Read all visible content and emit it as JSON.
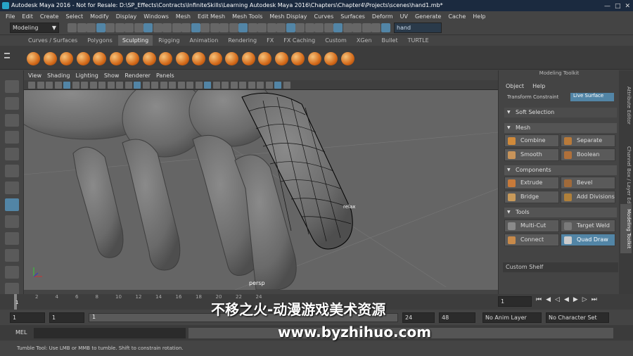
{
  "title": "Autodesk Maya 2016 - Not for Resale: D:\\SP_Effects\\Contracts\\InfiniteSkills\\Learning Autodesk Maya 2016\\Chapters\\Chapter4\\Projects\\scenes\\hand1.mb*",
  "menu": [
    "File",
    "Edit",
    "Create",
    "Select",
    "Modify",
    "Display",
    "Windows",
    "Mesh",
    "Edit Mesh",
    "Mesh Tools",
    "Mesh Display",
    "Curves",
    "Surfaces",
    "Deform",
    "UV",
    "Generate",
    "Cache",
    "Help"
  ],
  "mode_menu": "Modeling",
  "search_value": "hand",
  "shelf_tabs": [
    "Curves / Surfaces",
    "Polygons",
    "Sculpting",
    "Rigging",
    "Animation",
    "Rendering",
    "FX",
    "FX Caching",
    "Custom",
    "XGen",
    "Bullet",
    "TURTLE"
  ],
  "active_shelf_tab": "Sculpting",
  "viewport_menu": [
    "View",
    "Shading",
    "Lighting",
    "Show",
    "Renderer",
    "Panels"
  ],
  "viewport_labels": {
    "camera": "persp",
    "tool": "relax"
  },
  "modeling_toolkit": {
    "title": "Modeling Toolkit",
    "menu": [
      "Object",
      "Help"
    ],
    "transform_constraint": "Transform Constraint",
    "constraint_value": "Live Surface",
    "soft_selection": "Soft Selection",
    "sections": {
      "mesh": {
        "title": "Mesh",
        "buttons": [
          "Combine",
          "Separate",
          "Smooth",
          "Boolean"
        ]
      },
      "components": {
        "title": "Components",
        "buttons": [
          "Extrude",
          "Bevel",
          "Bridge",
          "Add Divisions"
        ]
      },
      "tools": {
        "title": "Tools",
        "buttons": [
          "Multi-Cut",
          "Target Weld",
          "Connect",
          "Quad Draw"
        ]
      }
    },
    "custom_shelf": "Custom Shelf"
  },
  "side_tabs": [
    "Attribute Editor",
    "Channel Box / Layer Editor",
    "Modeling Toolkit"
  ],
  "timeline": {
    "ticks": [
      "2",
      "4",
      "6",
      "8",
      "10",
      "12",
      "14",
      "16",
      "18",
      "20",
      "22",
      "24"
    ],
    "current": "1",
    "start_marker": "1"
  },
  "range": {
    "start": "1",
    "range_start": "1",
    "range_handle": "1",
    "range_end": "24",
    "end": "48",
    "anim_layer": "No Anim Layer",
    "char_set": "No Character Set"
  },
  "mel_label": "MEL",
  "help_text": "Tumble Tool: Use LMB or MMB to tumble. Shift to constrain rotation.",
  "watermark": {
    "line1": "不移之火-动漫游戏美术资源",
    "line2": "www.byzhihuo.com"
  },
  "colors": {
    "accent": "#5285a6",
    "shelf_ball": "#e08a2e"
  }
}
